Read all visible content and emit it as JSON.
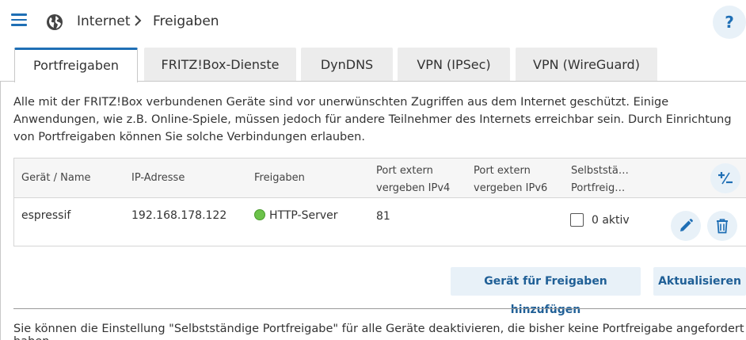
{
  "header": {
    "breadcrumb": [
      "Internet",
      "Freigaben"
    ],
    "help_label": "?"
  },
  "tabs": [
    {
      "label": "Portfreigaben",
      "active": true
    },
    {
      "label": "FRITZ!Box-Dienste",
      "active": false
    },
    {
      "label": "DynDNS",
      "active": false
    },
    {
      "label": "VPN (IPSec)",
      "active": false
    },
    {
      "label": "VPN (WireGuard)",
      "active": false
    }
  ],
  "intro_text": "Alle mit der FRITZ!Box verbundenen Geräte sind vor unerwünschten Zugriffen aus dem Internet geschützt. Einige Anwendungen, wie z.B. Online-Spiele, müssen jedoch für andere Teilnehmer des Internets erreichbar sein. Durch Einrichtung von Portfreigaben können Sie solche Verbindungen erlauben.",
  "table": {
    "columns": [
      "Gerät / Name",
      "IP-Adresse",
      "Freigaben",
      [
        "Port extern",
        "vergeben IPv4"
      ],
      [
        "Port extern",
        "vergeben IPv6"
      ],
      [
        "Selbststä…",
        "Portfreig…"
      ]
    ],
    "rows": [
      {
        "name": "espressif",
        "ip": "192.168.178.122",
        "freigabe": "HTTP-Server",
        "freigabe_status_color": "#6cc24a",
        "port_ipv4": "81",
        "port_ipv6": "",
        "selbst_label": "0 aktiv",
        "selbst_checked": false
      }
    ]
  },
  "buttons": {
    "add_device": "Gerät für Freigaben hinzufügen",
    "refresh": "Aktualisieren"
  },
  "footer_text": "Sie können die Einstellung \"Selbstständige Portfreigabe\" für alle Geräte deaktivieren, die bisher keine Portfreigabe angefordert haben.",
  "colors": {
    "accent": "#1f6fb5",
    "button_bg": "#e8f1f8",
    "status_ok": "#6cc24a"
  },
  "icons": [
    "menu-icon",
    "globe-icon",
    "chevron-right-icon",
    "plus-minus-icon",
    "pencil-icon",
    "trash-icon"
  ]
}
